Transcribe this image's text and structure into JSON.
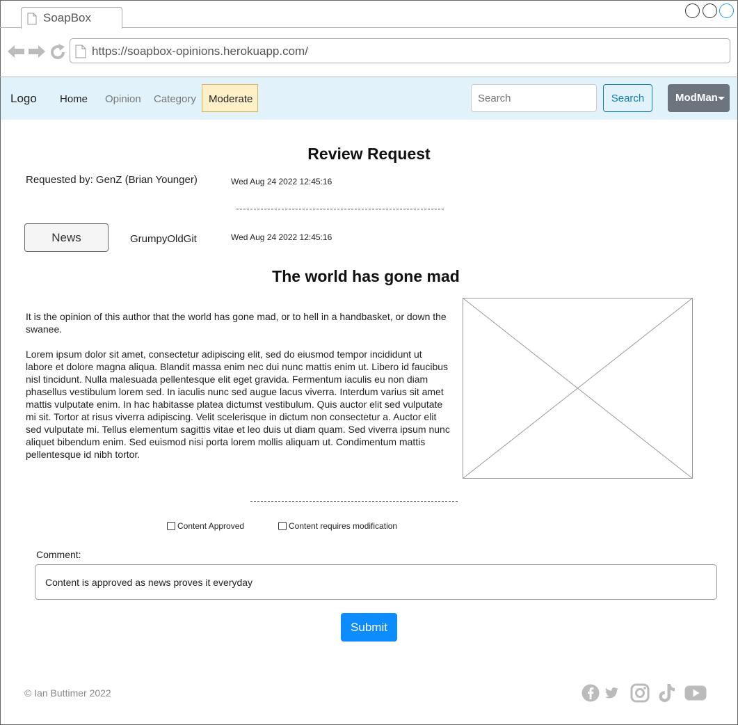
{
  "browser": {
    "tab_title": "SoapBox",
    "url": "https://soapbox-opinions.herokuapp.com/"
  },
  "navbar": {
    "brand": "Logo",
    "links": [
      "Home",
      "Opinion",
      "Category"
    ],
    "moderate": "Moderate",
    "search_placeholder": "Search",
    "search_button": "Search",
    "user_menu": "ModMan"
  },
  "review": {
    "title": "Review Request",
    "requested_by": "Requested by: GenZ (Brian Younger)",
    "requested_date": "Wed Aug 24 2022 12:45:16"
  },
  "opinion": {
    "category": "News",
    "author": "GrumpyOldGit",
    "date": "Wed Aug 24 2022 12:45:16",
    "title": "The world has gone mad",
    "intro": "It is the opinion of this author that the world has gone mad, or to hell in a handbasket, or down the swanee.",
    "body": "Lorem ipsum dolor sit amet, consectetur adipiscing elit, sed do eiusmod tempor incididunt ut labore et dolore magna aliqua. Blandit massa enim nec dui nunc mattis enim ut. Libero id faucibus nisl tincidunt. Nulla malesuada pellentesque elit eget gravida. Fermentum iaculis eu non diam phasellus vestibulum lorem sed. In iaculis nunc sed augue lacus viverra. Interdum varius sit amet mattis vulputate enim. In hac habitasse platea dictumst vestibulum. Quis auctor elit sed vulputate mi sit. Tortor at risus viverra adipiscing. Velit scelerisque in dictum non consectetur a. Auctor elit sed vulputate mi. Tellus elementum sagittis vitae et leo duis ut diam quam. Sed viverra ipsum nunc aliquet bibendum enim. Sed euismod nisi porta lorem mollis aliquam ut. Condimentum mattis pellentesque id nibh tortor."
  },
  "moderation": {
    "approved_label": "Content Approved",
    "modify_label": "Content requires modification",
    "approved_checked": false,
    "modify_checked": false,
    "comment_label": "Comment:",
    "comment_value": "Content is approved as news proves it everyday",
    "submit": "Submit"
  },
  "footer": {
    "copyright": "© Ian Buttimer 2022",
    "social_icons": [
      "facebook-icon",
      "twitter-icon",
      "instagram-icon",
      "tiktok-icon",
      "youtube-icon"
    ]
  },
  "colors": {
    "navbar_bg": "#e1f2fb",
    "moderate_bg": "#fff0c8",
    "primary": "#0d8cff",
    "search_outline": "#0e7fb0",
    "user_btn": "#6c757d"
  }
}
